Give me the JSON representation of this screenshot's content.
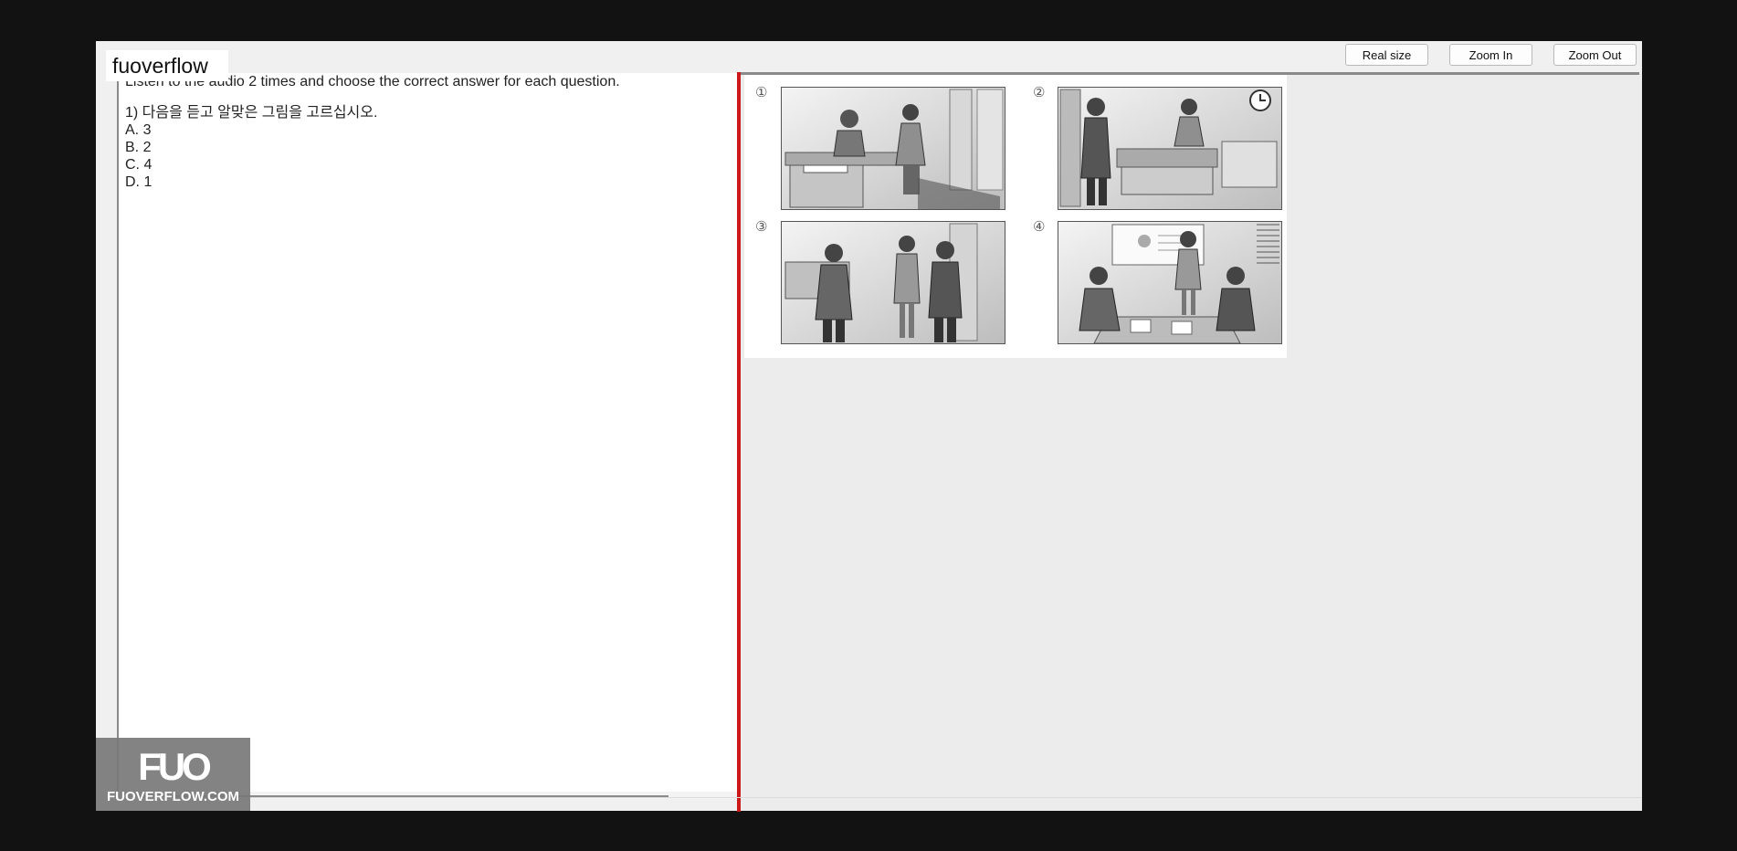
{
  "toolbar": {
    "real_size_label": "Real size",
    "zoom_in_label": "Zoom In",
    "zoom_out_label": "Zoom Out"
  },
  "brand": {
    "label": "fuoverflow"
  },
  "question": {
    "instruction": "Listen to the audio 2 times and choose the correct answer for each question.",
    "title": "1) 다음을 듣고 알맞은 그림을 고르십시오.",
    "options": [
      {
        "letter": "A.",
        "value": "3"
      },
      {
        "letter": "B.",
        "value": "2"
      },
      {
        "letter": "C.",
        "value": "4"
      },
      {
        "letter": "D.",
        "value": "1"
      }
    ]
  },
  "picture": {
    "panels": [
      {
        "number": "①"
      },
      {
        "number": "②"
      },
      {
        "number": "③"
      },
      {
        "number": "④"
      }
    ]
  },
  "logo": {
    "mark": "FUO",
    "text": "FUOVERFLOW.COM"
  },
  "colors": {
    "background": "#121212",
    "app_bg": "#f0f0f0",
    "splitter": "#cc1818"
  }
}
